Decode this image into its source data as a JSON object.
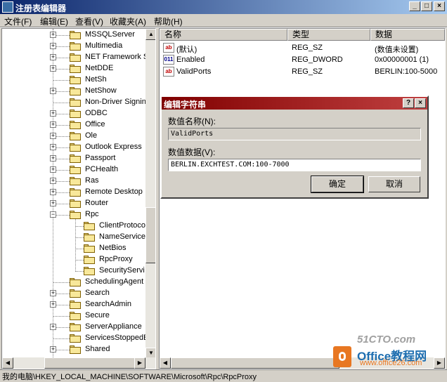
{
  "window": {
    "title": "注册表编辑器",
    "minimize_glyph": "_",
    "maximize_glyph": "□",
    "close_glyph": "×"
  },
  "menu": {
    "items": [
      {
        "label": "文件(F)"
      },
      {
        "label": "编辑(E)"
      },
      {
        "label": "查看(V)"
      },
      {
        "label": "收藏夹(A)"
      },
      {
        "label": "帮助(H)"
      }
    ]
  },
  "tree": {
    "items": [
      {
        "label": "MSSQLServer",
        "expander": "+"
      },
      {
        "label": "Multimedia",
        "expander": "+"
      },
      {
        "label": "NET Framework S",
        "expander": "+"
      },
      {
        "label": "NetDDE",
        "expander": "+"
      },
      {
        "label": "NetSh",
        "expander": ""
      },
      {
        "label": "NetShow",
        "expander": "+"
      },
      {
        "label": "Non-Driver Signin",
        "expander": ""
      },
      {
        "label": "ODBC",
        "expander": "+"
      },
      {
        "label": "Office",
        "expander": "+"
      },
      {
        "label": "Ole",
        "expander": "+"
      },
      {
        "label": "Outlook Express",
        "expander": "+"
      },
      {
        "label": "Passport",
        "expander": "+"
      },
      {
        "label": "PCHealth",
        "expander": "+"
      },
      {
        "label": "Ras",
        "expander": "+"
      },
      {
        "label": "Remote Desktop",
        "expander": "+"
      },
      {
        "label": "Router",
        "expander": "+"
      },
      {
        "label": "Rpc",
        "expander": "−"
      },
      {
        "label": "ClientProtoco",
        "expander": ""
      },
      {
        "label": "NameService",
        "expander": ""
      },
      {
        "label": "NetBios",
        "expander": ""
      },
      {
        "label": "RpcProxy",
        "expander": ""
      },
      {
        "label": "SecurityServi",
        "expander": ""
      },
      {
        "label": "SchedulingAgent",
        "expander": ""
      },
      {
        "label": "Search",
        "expander": "+"
      },
      {
        "label": "SearchAdmin",
        "expander": "+"
      },
      {
        "label": "Secure",
        "expander": ""
      },
      {
        "label": "ServerAppliance",
        "expander": "+"
      },
      {
        "label": "ServicesStoppedE",
        "expander": ""
      },
      {
        "label": "Shared",
        "expander": "+"
      }
    ]
  },
  "list": {
    "columns": [
      {
        "label": "名称"
      },
      {
        "label": "类型"
      },
      {
        "label": "数据"
      }
    ],
    "rows": [
      {
        "icon": "ab",
        "name": "(默认)",
        "type": "REG_SZ",
        "data": "(数值未设置)"
      },
      {
        "icon": "011",
        "name": "Enabled",
        "type": "REG_DWORD",
        "data": "0x00000001 (1)"
      },
      {
        "icon": "ab",
        "name": "ValidPorts",
        "type": "REG_SZ",
        "data": "BERLIN:100-5000"
      }
    ]
  },
  "dialog": {
    "title": "编辑字符串",
    "help_glyph": "?",
    "close_glyph": "×",
    "name_label": "数值名称(N):",
    "name_value": "ValidPorts",
    "data_label": "数值数据(V):",
    "data_value": "BERLIN.EXCHTEST.COM:100-7000",
    "ok_label": "确定",
    "cancel_label": "取消"
  },
  "statusbar": {
    "path": "我的电脑\\HKEY_LOCAL_MACHINE\\SOFTWARE\\Microsoft\\Rpc\\RpcProxy"
  },
  "watermark": {
    "top": "51CTO.com",
    "brand": "Office教程网",
    "url": "www.office26.com"
  }
}
